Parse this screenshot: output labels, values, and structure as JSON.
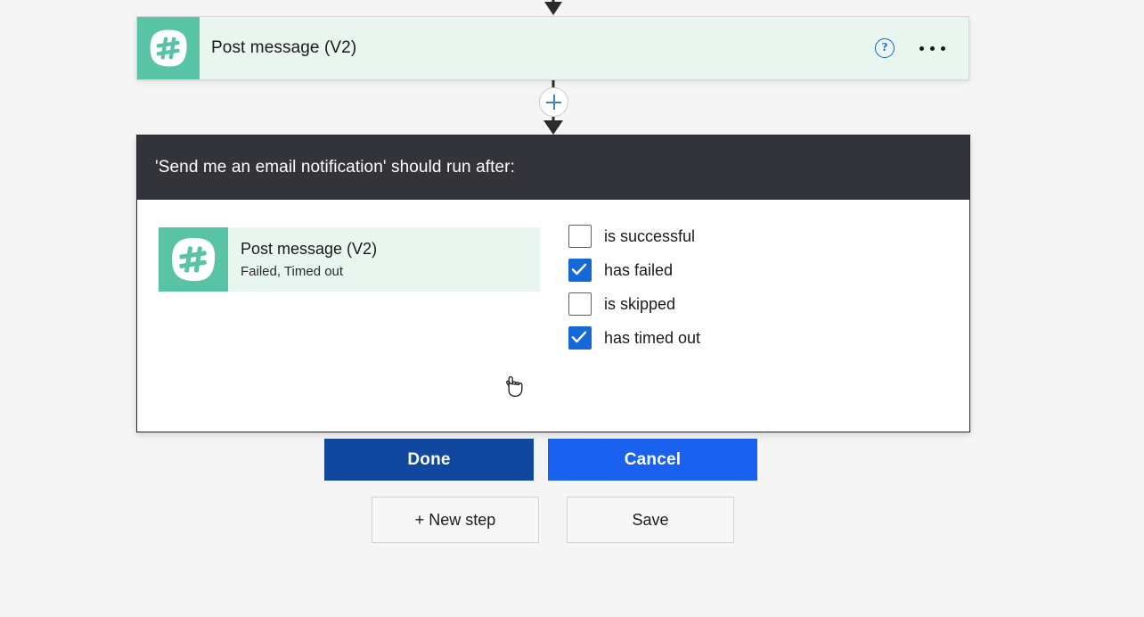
{
  "canvas": {
    "background_color": "#f5f5f5"
  },
  "action_card": {
    "icon": "teams-hashtag-icon",
    "title": "Post message (V2)",
    "help_icon": "help-circle-icon",
    "help_glyph": "?",
    "more_icon": "more-horizontal-icon",
    "icon_background": "#58c3a5",
    "card_background": "#e9f5ef"
  },
  "insert_step": {
    "icon": "plus-icon",
    "accent_color": "#3c84d1"
  },
  "dialog": {
    "title": "'Send me an email notification' should run after:",
    "header_background": "#33333a",
    "action_summary": {
      "icon": "teams-hashtag-icon",
      "title": "Post message (V2)",
      "status": "Failed, Timed out"
    },
    "checkboxes": [
      {
        "label": "is successful",
        "checked": false
      },
      {
        "label": "has failed",
        "checked": true
      },
      {
        "label": "is skipped",
        "checked": false
      },
      {
        "label": "has timed out",
        "checked": true
      }
    ],
    "checked_color": "#1569d6",
    "buttons": {
      "done_label": "Done",
      "done_color": "#10489f",
      "cancel_label": "Cancel",
      "cancel_color": "#1a61f0"
    }
  },
  "footer": {
    "new_step_label": "+ New step",
    "save_label": "Save"
  },
  "cursor": {
    "type": "pointing-hand-cursor"
  }
}
